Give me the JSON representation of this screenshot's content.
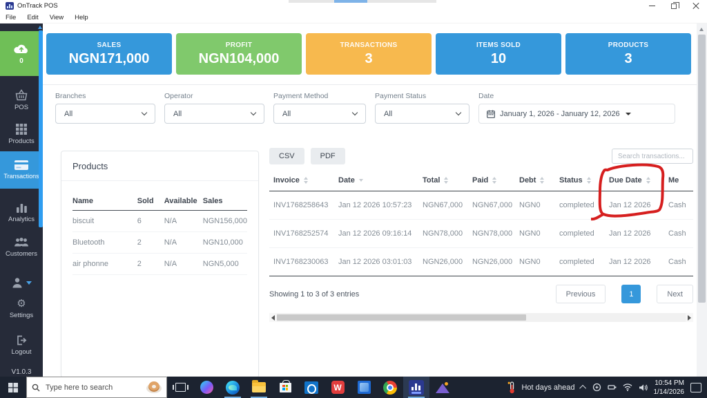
{
  "window": {
    "title": "OnTrack POS",
    "menu": [
      "File",
      "Edit",
      "View",
      "Help"
    ]
  },
  "sidebar": {
    "items": [
      {
        "icon": "cloud-upload-icon",
        "label": "0"
      },
      {
        "icon": "basket-icon",
        "label": "POS"
      },
      {
        "icon": "grid-icon",
        "label": "Products"
      },
      {
        "icon": "credit-card-icon",
        "label": "Transactions"
      },
      {
        "icon": "bar-chart-icon",
        "label": "Analytics"
      },
      {
        "icon": "users-icon",
        "label": "Customers"
      },
      {
        "icon": "user-icon",
        "label": ""
      },
      {
        "icon": "gears-icon",
        "label": "Settings"
      },
      {
        "icon": "logout-icon",
        "label": "Logout"
      }
    ],
    "active_item": "Transactions",
    "version": "V1.0.3"
  },
  "stats_cards": [
    {
      "label": "SALES",
      "value": "NGN171,000",
      "color": "#3598db"
    },
    {
      "label": "PROFIT",
      "value": "NGN104,000",
      "color": "#80c96c"
    },
    {
      "label": "TRANSACTIONS",
      "value": "3",
      "color": "#f7b94e"
    },
    {
      "label": "ITEMS SOLD",
      "value": "10",
      "color": "#3598db"
    },
    {
      "label": "PRODUCTS",
      "value": "3",
      "color": "#3598db"
    }
  ],
  "filters": {
    "branches": {
      "label": "Branches",
      "value": "All"
    },
    "operator": {
      "label": "Operator",
      "value": "All"
    },
    "payment_method": {
      "label": "Payment Method",
      "value": "All"
    },
    "payment_status": {
      "label": "Payment Status",
      "value": "All"
    },
    "date": {
      "label": "Date",
      "value": "January 1, 2026 - January 12, 2026"
    }
  },
  "products_panel": {
    "title": "Products",
    "columns": [
      "Name",
      "Sold",
      "Available",
      "Sales"
    ],
    "rows": [
      [
        "biscuit",
        "6",
        "N/A",
        "NGN156,000"
      ],
      [
        "Bluetooth",
        "2",
        "N/A",
        "NGN10,000"
      ],
      [
        "air phonne",
        "2",
        "N/A",
        "NGN5,000"
      ]
    ]
  },
  "transactions_panel": {
    "export_csv": "CSV",
    "export_pdf": "PDF",
    "search_placeholder": "Search transactions...",
    "columns": [
      "Invoice",
      "Date",
      "Total",
      "Paid",
      "Debt",
      "Status",
      "Due Date",
      "Me"
    ],
    "rows": [
      [
        "INV1768258643",
        "Jan 12 2026 10:57:23",
        "NGN67,000",
        "NGN67,000",
        "NGN0",
        "completed",
        "Jan 12 2026",
        "Cash"
      ],
      [
        "INV1768252574",
        "Jan 12 2026 09:16:14",
        "NGN78,000",
        "NGN78,000",
        "NGN0",
        "completed",
        "Jan 12 2026",
        "Cash"
      ],
      [
        "INV1768230063",
        "Jan 12 2026 03:01:03",
        "NGN26,000",
        "NGN26,000",
        "NGN0",
        "completed",
        "Jan 12 2026",
        "Cash"
      ]
    ],
    "footer": "Showing 1 to 3 of 3 entries",
    "pagination": {
      "previous": "Previous",
      "page": "1",
      "next": "Next"
    }
  },
  "annotation": {
    "shape": "hand-drawn-circle",
    "color": "#d61f1f",
    "target": "Due Date column"
  },
  "taskbar": {
    "search_placeholder": "Type here to search",
    "wps_letter": "W",
    "weather": "Hot days ahead",
    "clock": {
      "time": "10:54 PM",
      "date": "1/14/2026"
    }
  }
}
